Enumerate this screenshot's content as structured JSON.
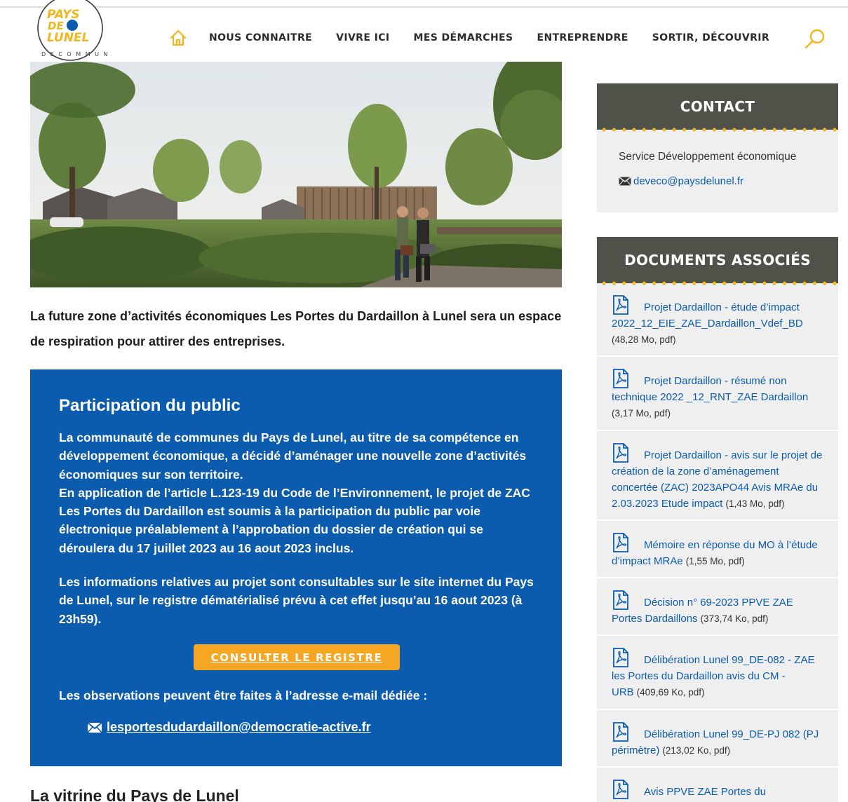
{
  "header": {
    "logo_line1": "PAYS",
    "logo_line2": "DE",
    "logo_line3": "LUNEL",
    "logo_ring": "DE COMMUNES",
    "nav": [
      "NOUS CONNAITRE",
      "VIVRE ICI",
      "MES DÉMARCHES",
      "ENTREPRENDRE",
      "SORTIR, DÉCOUVRIR"
    ],
    "home_icon": "home-icon",
    "search_icon": "search-icon"
  },
  "main": {
    "intro": "La future zone d’activités économiques Les Portes du Dardaillon à Lunel sera un espace de respiration pour attirer des entreprises.",
    "participation": {
      "title": "Participation du public",
      "p1": "La communauté de communes du Pays de Lunel, au titre de sa compétence en développement économique, a décidé d’aménager une nouvelle zone d’activités économiques sur son territoire.",
      "p1b": "En application de l’article L.123-19 du Code de l’Environnement, le projet de ZAC Les Portes du Dardaillon est soumis à la participation du public par voie électronique préalablement à l’approbation du dossier de création qui se déroulera du 17 juillet 2023 au 16 aout 2023 inclus.",
      "p2": "Les informations relatives au projet sont consultables sur le site internet du Pays de Lunel, sur le registre dématérialisé prévu à cet effet  jusqu’au 16 aout 2023 (à 23h59).",
      "cta": "CONSULTER LE REGISTRE",
      "p3": "Les observations peuvent être faites à l’adresse e-mail dédiée :",
      "email": "lesportesdudardaillon@democratie-active.fr"
    },
    "next_heading": "La vitrine du Pays de Lunel"
  },
  "sidebar": {
    "contact": {
      "title": "CONTACT",
      "service": "Service Développement économique",
      "email": "deveco@paysdelunel.fr"
    },
    "documents": {
      "title": "DOCUMENTS ASSOCIÉS",
      "items": [
        {
          "label": "Projet Dardaillon - étude d’impact 2022_12_EIE_ZAE_Dardaillon_Vdef_BD",
          "meta": "(48,28 Mo, pdf)"
        },
        {
          "label": "Projet Dardaillon - résumé non technique 2022 _12_RNT_ZAE Dardaillon",
          "meta": "(3,17 Mo, pdf)"
        },
        {
          "label": "Projet Dardaillon - avis sur le projet de création de la zone d’aménagement concertée (ZAC) 2023APO44 Avis MRAe du 2.03.2023 Etude impact",
          "meta": "(1,43 Mo, pdf)"
        },
        {
          "label": "Mémoire en réponse du MO à l’étude d’impact MRAe",
          "meta": "(1,55 Mo, pdf)"
        },
        {
          "label": "Décision n° 69-2023 PPVE ZAE Portes Dardaillons",
          "meta": "(373,74 Ko, pdf)"
        },
        {
          "label": "Délibération Lunel 99_DE-082 - ZAE les Portes du Dardaillon avis du CM - URB",
          "meta": "(409,69 Ko, pdf)"
        },
        {
          "label": "Délibération Lunel 99_DE-PJ 082 (PJ périmètre)",
          "meta": "(213,02 Ko, pdf)"
        },
        {
          "label": "Avis PPVE ZAE Portes du",
          "meta": ""
        }
      ]
    }
  }
}
